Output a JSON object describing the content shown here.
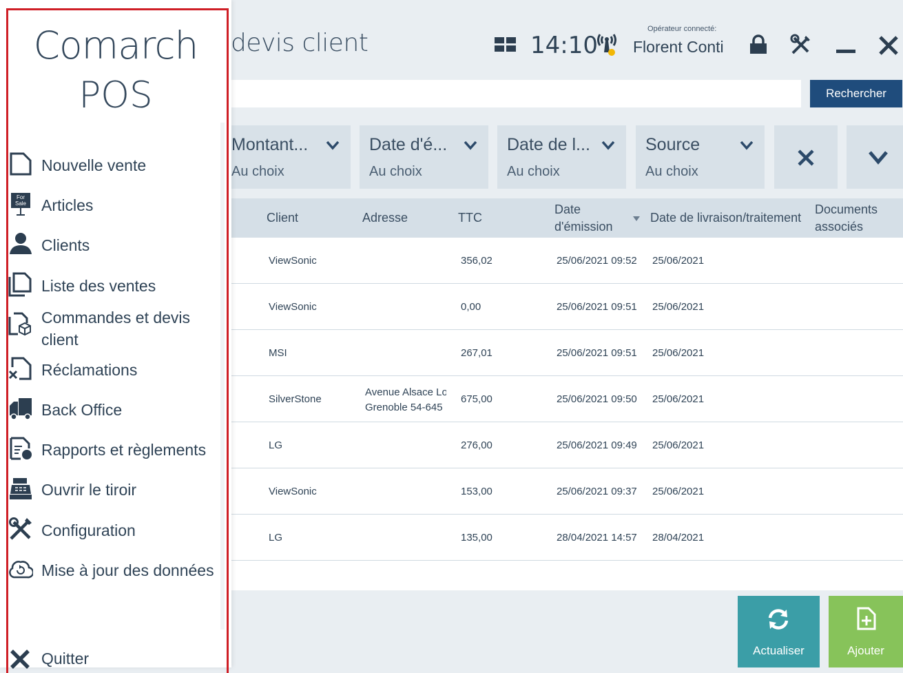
{
  "header": {
    "title": "devis client",
    "clock": "14:10",
    "operator_label": "Opérateur connecté:",
    "operator_name": "Florent Conti"
  },
  "search": {
    "value": "",
    "button_label": "Rechercher"
  },
  "filters": [
    {
      "label": "Montant...",
      "value": "Au choix"
    },
    {
      "label": "Date d'é...",
      "value": "Au choix"
    },
    {
      "label": "Date de l...",
      "value": "Au choix"
    },
    {
      "label": "Source",
      "value": "Au choix"
    }
  ],
  "table": {
    "columns": {
      "client": "Client",
      "adresse": "Adresse",
      "ttc": "TTC",
      "date_emission_1": "Date",
      "date_emission_2": "d'émission",
      "date_livraison": "Date de livraison/traitement",
      "documents_1": "Documents",
      "documents_2": "associés"
    },
    "rows": [
      {
        "client": "ViewSonic",
        "adresse1": "",
        "adresse2": "",
        "ttc": "356,02",
        "date_emission": "25/06/2021 09:52",
        "date_livraison": "25/06/2021"
      },
      {
        "client": "ViewSonic",
        "adresse1": "",
        "adresse2": "",
        "ttc": "0,00",
        "date_emission": "25/06/2021 09:51",
        "date_livraison": "25/06/2021"
      },
      {
        "client": "MSI",
        "adresse1": "",
        "adresse2": "",
        "ttc": "267,01",
        "date_emission": "25/06/2021 09:51",
        "date_livraison": "25/06/2021"
      },
      {
        "client": "SilverStone",
        "adresse1": "Avenue Alsace Lo",
        "adresse2": "Grenoble 54-645",
        "ttc": "675,00",
        "date_emission": "25/06/2021 09:50",
        "date_livraison": "25/06/2021"
      },
      {
        "client": "LG",
        "adresse1": "",
        "adresse2": "",
        "ttc": "276,00",
        "date_emission": "25/06/2021 09:49",
        "date_livraison": "25/06/2021"
      },
      {
        "client": "ViewSonic",
        "adresse1": "",
        "adresse2": "",
        "ttc": "153,00",
        "date_emission": "25/06/2021 09:37",
        "date_livraison": "25/06/2021"
      },
      {
        "client": "LG",
        "adresse1": "",
        "adresse2": "",
        "ttc": "135,00",
        "date_emission": "28/04/2021 14:57",
        "date_livraison": "28/04/2021"
      }
    ]
  },
  "actions": {
    "refresh_label": "Actualiser",
    "add_label": "Ajouter"
  },
  "sidebar": {
    "logo_line1": "Comarch",
    "logo_line2": "POS",
    "items": [
      {
        "label": "Nouvelle vente",
        "icon": "document-icon"
      },
      {
        "label": "Articles",
        "icon": "for-sale-sign-icon",
        "icon_text_1": "For",
        "icon_text_2": "Sale"
      },
      {
        "label": "Clients",
        "icon": "person-icon"
      },
      {
        "label": "Liste des ventes",
        "icon": "documents-stack-icon"
      },
      {
        "label": "Commandes et devis",
        "label2": "client",
        "icon": "document-box-icon"
      },
      {
        "label": "Réclamations",
        "icon": "document-x-icon"
      },
      {
        "label": "Back Office",
        "icon": "truck-icon"
      },
      {
        "label": "Rapports et règlements",
        "icon": "report-icon"
      },
      {
        "label": "Ouvrir le tiroir",
        "icon": "cash-register-icon"
      },
      {
        "label": "Configuration",
        "icon": "tools-icon"
      },
      {
        "label": "Mise à jour des données",
        "icon": "cloud-sync-icon"
      }
    ],
    "quit_label": "Quitter"
  },
  "colors": {
    "accent_blue": "#1f4c7c",
    "refresh_teal": "#3b9ea7",
    "add_green": "#87c35a",
    "highlight_red": "#cf1f26"
  }
}
